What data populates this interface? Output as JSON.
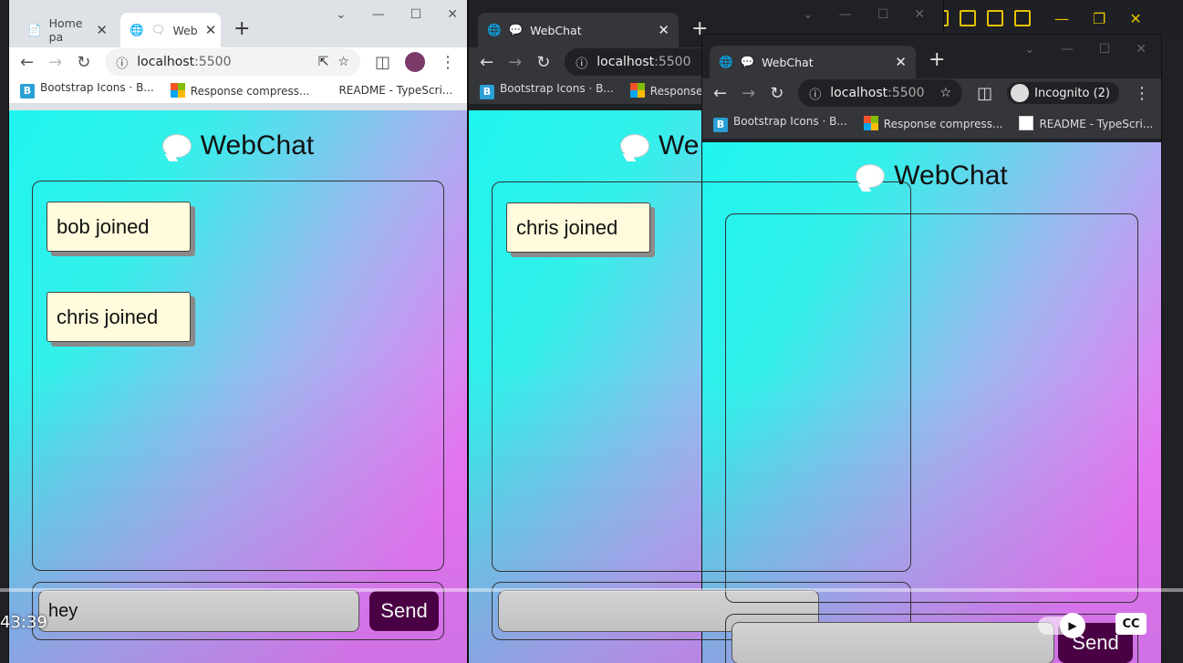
{
  "browser1": {
    "tabs": [
      {
        "label": "Home pa"
      },
      {
        "label": "Web"
      }
    ],
    "url_host": "localhost",
    "url_port": ":5500",
    "bookmarks": [
      "Bootstrap Icons · B...",
      "Response compress...",
      "README - TypeScri..."
    ],
    "page_title": "WebChat",
    "messages": [
      "bob joined",
      "chris joined"
    ],
    "input_value": "hey",
    "send_label": "Send"
  },
  "browser2": {
    "tab_label": "WebChat",
    "url_host": "localhost",
    "url_port": ":5500",
    "bookmarks": [
      "Bootstrap Icons · B...",
      "Response cor"
    ],
    "page_title": "We",
    "messages": [
      "chris joined"
    ]
  },
  "browser3": {
    "tab_label": "WebChat",
    "url_host": "localhost",
    "url_port": ":5500",
    "incognito_label": "Incognito (2)",
    "bookmarks": [
      "Bootstrap Icons · B...",
      "Response compress...",
      "README - TypeScri..."
    ],
    "page_title": "WebChat",
    "send_label": "Send"
  },
  "video": {
    "timestamp": "43:39",
    "cc_label": "CC"
  },
  "icons": [
    "globe-icon",
    "chat-bubble-icon",
    "back-icon",
    "forward-icon",
    "reload-icon",
    "star-icon",
    "info-icon",
    "incognito-icon",
    "more-icon",
    "close-icon",
    "plus-icon"
  ],
  "colors": {
    "light_chrome": "#dee1e6",
    "dark_chrome": "#35363a",
    "send_bg": "#4a0044",
    "message_bg": "#fffbdc",
    "accent": "#e6c300"
  }
}
